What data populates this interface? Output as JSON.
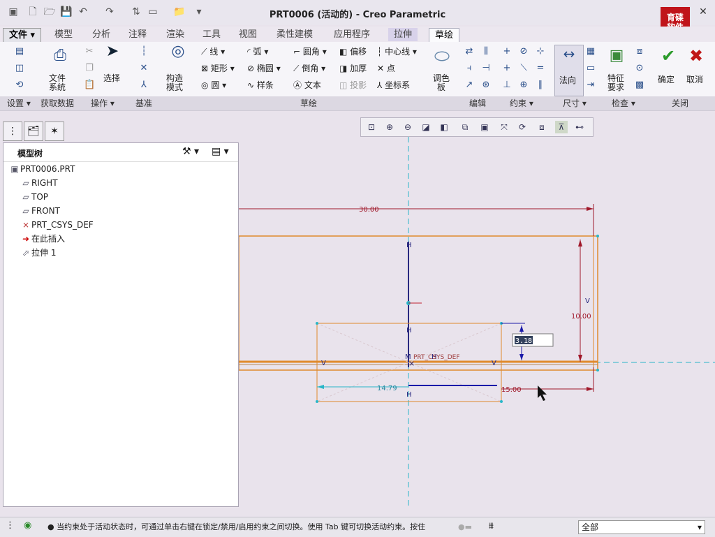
{
  "window": {
    "title": "PRT0006 (活动的) - Creo Parametric"
  },
  "menu_tabs": [
    "文件",
    "模型",
    "分析",
    "注释",
    "渲染",
    "工具",
    "视图",
    "柔性建模",
    "应用程序",
    "拉伸",
    "草绘"
  ],
  "active_tab": "草绘",
  "ribbon": {
    "file_system": "文件\n系统",
    "select": "选择",
    "construct_mode": "构造\n模式",
    "line": "线",
    "arc": "弧",
    "fillet": "圆角",
    "offset": "偏移",
    "centerline": "中心线",
    "rectangle": "矩形",
    "ellipse": "椭圆",
    "chamfer": "倒角",
    "thicken": "加厚",
    "point": "点",
    "circle": "圆",
    "spline": "样条",
    "text": "文本",
    "project": "投影",
    "coord_sys": "坐标系",
    "palette": "调色\n板",
    "normal": "法向",
    "feature_req": "特征\n要求",
    "confirm": "确定",
    "cancel": "取消"
  },
  "groups": {
    "settings": "设置",
    "get_data": "获取数据",
    "operations": "操作",
    "datum": "基准",
    "sketch": "草绘",
    "edit": "编辑",
    "constrain": "约束",
    "dimension": "尺寸",
    "inspect": "检查",
    "close": "关闭"
  },
  "logo_text": "育碟\n软件",
  "model_tree": {
    "title": "模型树",
    "items": [
      {
        "label": "PRT0006.PRT",
        "icon": "part-icon"
      },
      {
        "label": "RIGHT",
        "icon": "datum-plane-icon"
      },
      {
        "label": "TOP",
        "icon": "datum-plane-icon"
      },
      {
        "label": "FRONT",
        "icon": "datum-plane-icon"
      },
      {
        "label": "PRT_CSYS_DEF",
        "icon": "csys-icon"
      },
      {
        "label": "在此插入",
        "icon": "insert-arrow-icon"
      },
      {
        "label": "拉伸 1",
        "icon": "extrude-icon"
      }
    ]
  },
  "sketch": {
    "dim_width": "30.00",
    "dim_height": "10.00",
    "dim_rect_width": "14.79",
    "dim_offset": "15.00",
    "dim_edit_value": "3.18",
    "csys_label": "PRT_CSYS_DEF",
    "constraint_h": "H",
    "constraint_v": "V",
    "constraint_m": "M"
  },
  "status": {
    "message": "● 当约束处于活动状态时，可通过单击右键在锁定/禁用/启用约束之间切换。使用 Tab 键可切换活动约束。按住",
    "filter_value": "全部"
  },
  "colors": {
    "dimension": "#a0182a",
    "geometry": "#e08a2c",
    "reference": "#29b6c8",
    "highlight": "#1a1aa8"
  }
}
